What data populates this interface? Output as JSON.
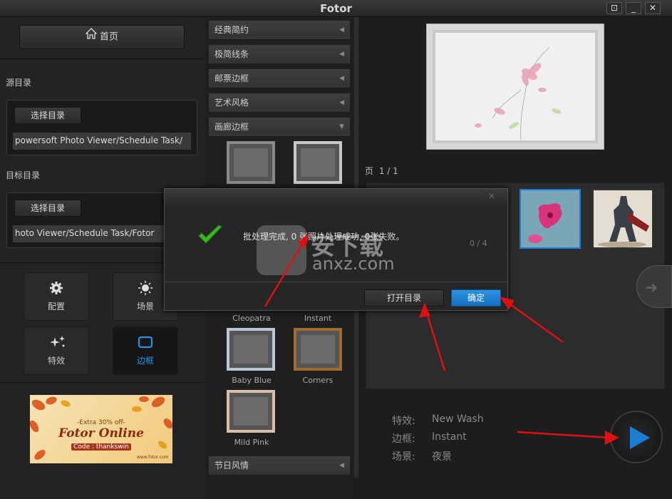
{
  "app": {
    "title": "Fotor"
  },
  "window_buttons": {
    "restore": "⊡",
    "minimize": "_",
    "close": "✕"
  },
  "sidebar": {
    "home_label": "首页",
    "source_label": "源目录",
    "source_select_label": "选择目录",
    "source_path": "powersoft Photo Viewer/Schedule Task/",
    "target_label": "目标目录",
    "target_select_label": "选择目录",
    "target_path": "hoto Viewer/Schedule Task/Fotor",
    "tiles": [
      {
        "label": "配置",
        "icon": "gear-icon"
      },
      {
        "label": "场景",
        "icon": "sun-icon"
      },
      {
        "label": "特效",
        "icon": "sparkle-icon"
      },
      {
        "label": "边框",
        "icon": "frame-icon"
      }
    ],
    "ad": {
      "line1": "-Extra 30% off-",
      "line2": "Fotor Online",
      "line3": "Code : thankswin",
      "site": "www.fotor.com"
    }
  },
  "categories": [
    {
      "label": "经典简约"
    },
    {
      "label": "极简线条"
    },
    {
      "label": "邮票边框"
    },
    {
      "label": "艺术风格"
    },
    {
      "label": "画廊边框"
    },
    {
      "label": "节日风情"
    }
  ],
  "frames": [
    {
      "name": "Cleopatra"
    },
    {
      "name": "Instant"
    },
    {
      "name": "Baby Blue"
    },
    {
      "name": "Corners"
    },
    {
      "name": "Mild Pink"
    }
  ],
  "preview": {
    "page_label": "页",
    "page_value": "1 / 1"
  },
  "summary": {
    "effect_label": "特效:",
    "effect_value": "New Wash",
    "frame_label": "边框:",
    "frame_value": "Instant",
    "scene_label": "场景:",
    "scene_value": "夜景"
  },
  "dialog": {
    "message": "批处理完成, 0 张照片处理成功, 0张失败。",
    "progress": "0 / 4",
    "open_dir_label": "打开目录",
    "ok_label": "确定"
  },
  "watermark": {
    "text1": "安下载",
    "text2": "anxz.com"
  },
  "colors": {
    "accent": "#1a7fd4",
    "bg": "#1c1c1c",
    "arrow": "#e01010"
  }
}
